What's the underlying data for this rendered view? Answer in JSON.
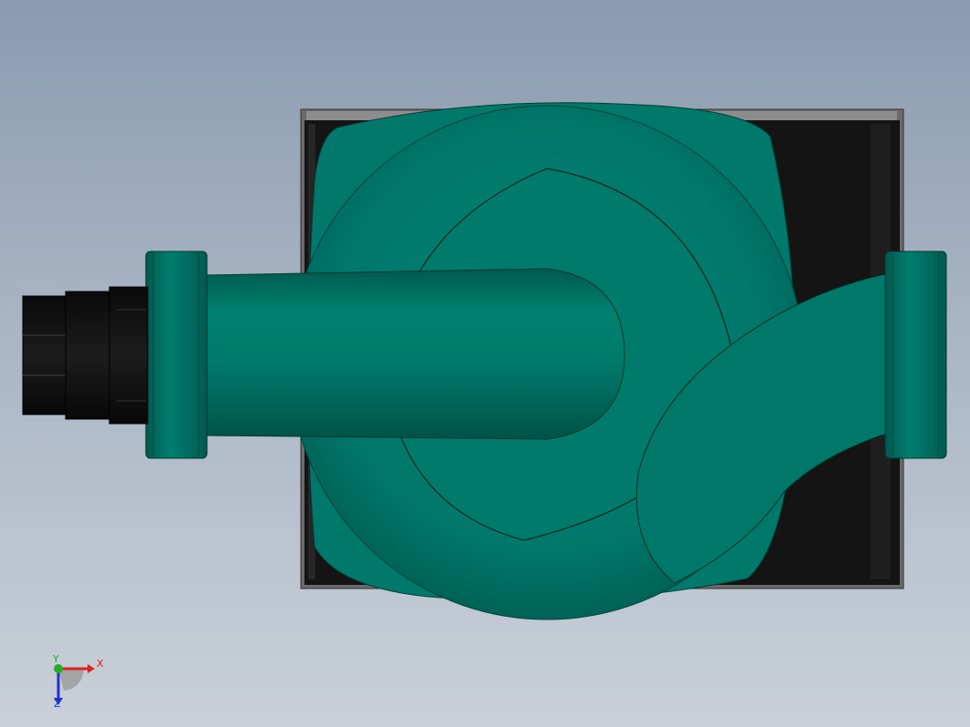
{
  "viewport": {
    "background_top": "#8a9bb0",
    "background_bottom": "#c9d0d9"
  },
  "model": {
    "body_color": "#00796b",
    "housing_color": "#131313",
    "frame_color": "#5c5c5c"
  },
  "triad": {
    "x_label": "X",
    "y_label": "Y",
    "z_label": "Z",
    "x_color": "#e02020",
    "y_color": "#20b020",
    "z_color": "#2030d0"
  }
}
